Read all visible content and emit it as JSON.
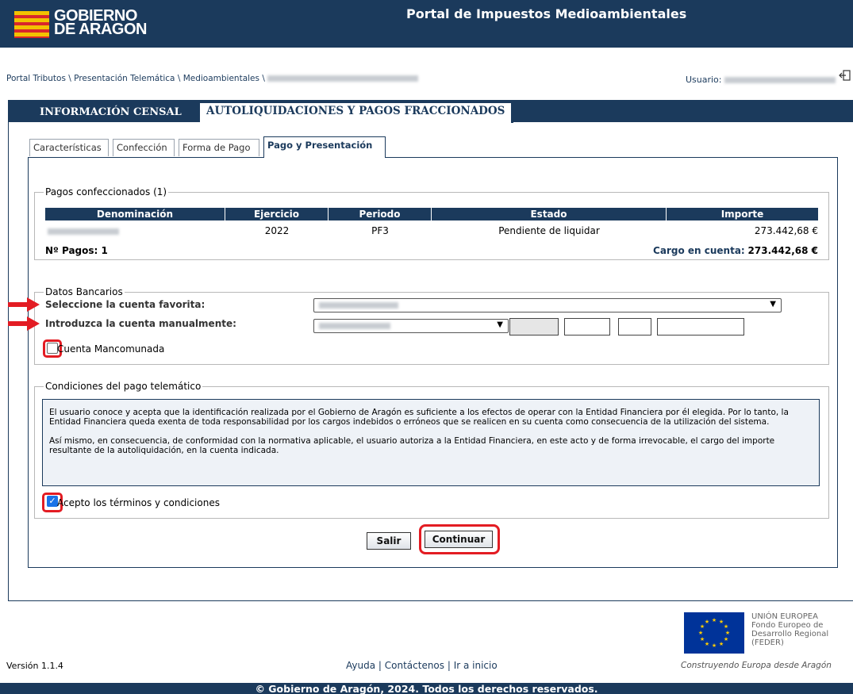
{
  "header": {
    "logo_line1": "GOBIERNO",
    "logo_line2": "DE ARAGON",
    "portal_title": "Portal de Impuestos Medioambientales"
  },
  "breadcrumb": {
    "items": [
      "Portal Tributos",
      "Presentación Telemática",
      "Medioambientales"
    ],
    "separator": " \\ "
  },
  "user": {
    "label": "Usuario:"
  },
  "main_tabs": {
    "censal": "INFORMACIÓN CENSAL",
    "autoliq": "AUTOLIQUIDACIONES Y PAGOS FRACCIONADOS"
  },
  "sub_tabs": [
    "Características",
    "Confección",
    "Forma de Pago",
    "Pago y Presentación"
  ],
  "pagos": {
    "legend": "Pagos confeccionados (1)",
    "columns": [
      "Denominación",
      "Ejercicio",
      "Periodo",
      "Estado",
      "Importe"
    ],
    "row": {
      "ejercicio": "2022",
      "periodo": "PF3",
      "estado": "Pendiente de liquidar",
      "importe": "273.442,68 €"
    },
    "num_pagos_label": "Nº Pagos: 1",
    "cargo_label": "Cargo en cuenta:",
    "cargo_value": "273.442,68 €"
  },
  "bancarios": {
    "legend": "Datos Bancarios",
    "favorita_label": "Seleccione la cuenta favorita:",
    "manual_label": "Introduzca la cuenta manualmente:",
    "mancomunada_label": "Cuenta Mancomunada",
    "mancomunada_checked": false
  },
  "condiciones": {
    "legend": "Condiciones del pago telemático",
    "para1": "El usuario conoce y acepta que la identificación realizada por el Gobierno de Aragón es suficiente a los efectos de operar con la Entidad Financiera por él elegida. Por lo tanto, la Entidad Financiera queda exenta de toda responsabilidad por los cargos indebidos o erróneos que se realicen en su cuenta como consecuencia de la utilización del sistema.",
    "para2": "Así mismo, en consecuencia, de conformidad con la normativa aplicable, el usuario autoriza a la Entidad Financiera, en este acto y de forma irrevocable, el cargo del importe resultante de la autoliquidación, en la cuenta indicada.",
    "acepto_label": "Acepto los términos y condiciones",
    "acepto_checked": true
  },
  "buttons": {
    "salir": "Salir",
    "continuar": "Continuar"
  },
  "footer": {
    "version": "Versión 1.1.4",
    "links": [
      "Ayuda",
      "Contáctenos",
      "Ir a inicio"
    ],
    "eu_lines": [
      "UNIÓN EUROPEA",
      "Fondo Europeo de",
      "Desarrollo Regional",
      "(FEDER)"
    ],
    "eu_slogan": "Construyendo Europa desde Aragón",
    "copyright": "© Gobierno de Aragón, 2024. Todos los derechos reservados."
  },
  "colors": {
    "navy": "#1b3a5c",
    "highlight_red": "#e31c23"
  }
}
